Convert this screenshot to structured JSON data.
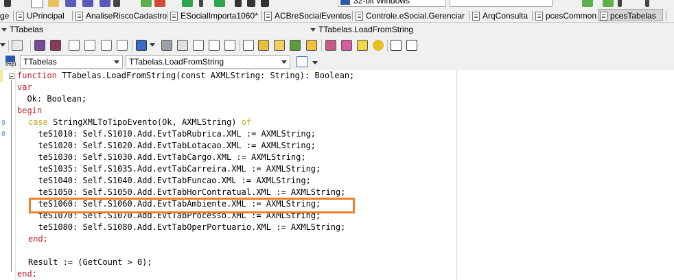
{
  "top_toolbar": {
    "platform": "32-bit Windows"
  },
  "tabs": [
    {
      "label": "ge"
    },
    {
      "label": "UPrincipal"
    },
    {
      "label": "AnaliseRiscoCadastro"
    },
    {
      "label": "ESocialImporta1060*"
    },
    {
      "label": "ACBreSocialEventos"
    },
    {
      "label": "Controle.eSocial.Gerenciar"
    },
    {
      "label": "ArqConsulta"
    },
    {
      "label": "pcesCommon"
    },
    {
      "label": "pcesTabelas"
    }
  ],
  "breadcrumb": {
    "left": "TTabelas",
    "right": "TTabelas.LoadFromString"
  },
  "combos": {
    "impl_label": "Impl",
    "class_combo": "TTabelas",
    "method_combo": "TTabelas.LoadFromString"
  },
  "gutter": {
    "line_9": "9",
    "line_0": "0"
  },
  "code": {
    "l1_kw": "function",
    "l1_rest": " TTabelas.LoadFromString(const AXMLString: String): Boolean;",
    "l2": "var",
    "l3": "  Ok: Boolean;",
    "l4": "begin",
    "l5_kw": "case",
    "l5_mid": " StringXMLToTipoEvento(Ok, AXMLString) ",
    "l5_of": "of",
    "l6": "  teS1010: Self.S1010.Add.EvtTabRubrica.XML := AXMLString;",
    "l7": "  teS1020: Self.S1020.Add.EvtTabLotacao.XML := AXMLString;",
    "l8": "  teS1030: Self.S1030.Add.EvtTabCargo.XML := AXMLString;",
    "l9": "  teS1035: Self.S1035.Add.evtTabCarreira.XML := AXMLString;",
    "l10": "  teS1040: Self.S1040.Add.EvtTabFuncao.XML := AXMLString;",
    "l11": "  teS1050: Self.S1050.Add.EvtTabHorContratual.XML := AXMLString;",
    "l12": "  teS1060: Self.S1060.Add.EvtTabAmbiente.XML := AXMLString;",
    "l13": "  teS1070: Self.S1070.Add.EvtTabProcesso.XML := AXMLString;",
    "l14": "  teS1080: Self.S1080.Add.EvtTabOperPortuario.XML := AXMLString;",
    "l15": "end;",
    "l16": "",
    "l17": "Result := (GetCount > 0);",
    "l18": "end;"
  },
  "colors": {
    "keyword": "#c0232b",
    "of_keyword": "#c8a62a",
    "highlight_box": "#f07f27"
  }
}
